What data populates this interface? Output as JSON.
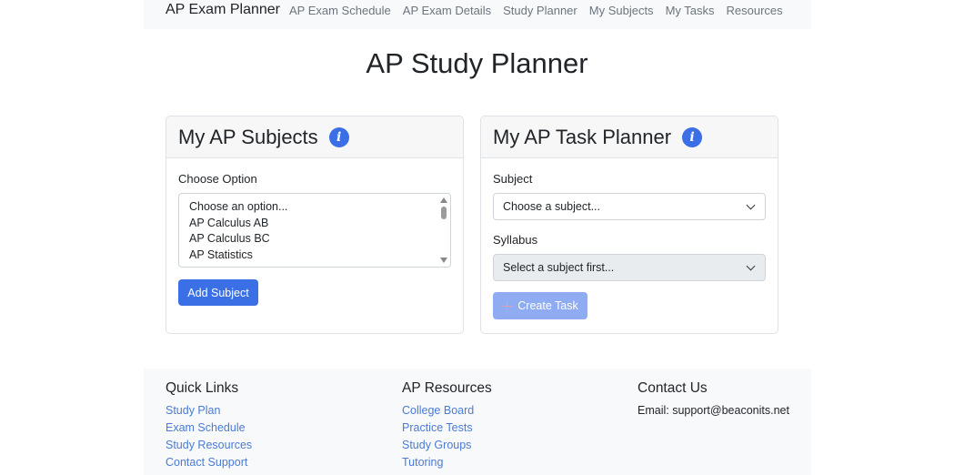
{
  "navbar": {
    "brand": "AP Exam Planner",
    "links": [
      "AP Exam Schedule",
      "AP Exam Details",
      "Study Planner",
      "My Subjects",
      "My Tasks",
      "Resources"
    ]
  },
  "page_title": "AP Study Planner",
  "subjects_card": {
    "title": "My AP Subjects",
    "info_icon": "info-icon",
    "choose_label": "Choose Option",
    "options": [
      "Choose an option...",
      "AP Calculus AB",
      "AP Calculus BC",
      "AP Statistics"
    ],
    "add_button": "Add Subject"
  },
  "task_card": {
    "title": "My AP Task Planner",
    "info_icon": "info-icon",
    "subject_label": "Subject",
    "subject_select": "Choose a subject...",
    "syllabus_label": "Syllabus",
    "syllabus_select": "Select a subject first...",
    "create_button": "Create Task"
  },
  "footer": {
    "quick_links": {
      "heading": "Quick Links",
      "links": [
        "Study Plan",
        "Exam Schedule",
        "Study Resources",
        "Contact Support"
      ]
    },
    "ap_resources": {
      "heading": "AP Resources",
      "links": [
        "College Board",
        "Practice Tests",
        "Study Groups",
        "Tutoring"
      ]
    },
    "contact": {
      "heading": "Contact Us",
      "email": "Email: support@beaconits.net"
    }
  },
  "colors": {
    "primary": "#3b6fe6",
    "primary_disabled": "#8fabf2",
    "link": "#4a7bd6",
    "navbar_bg": "#f8f9fa"
  }
}
